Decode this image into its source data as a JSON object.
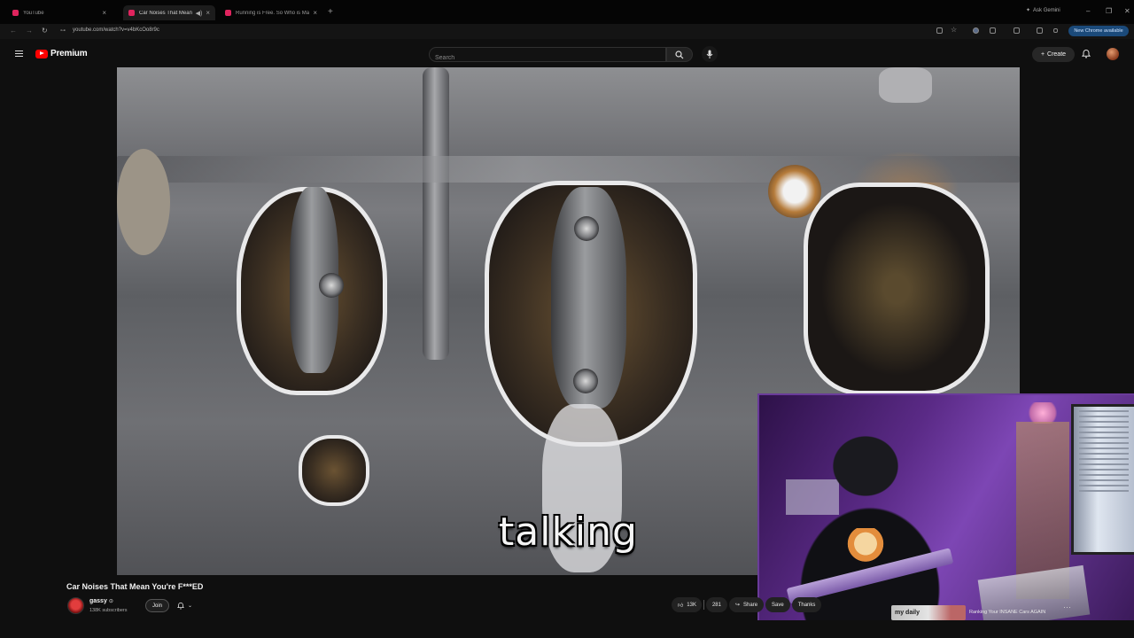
{
  "browser": {
    "tabs": [
      {
        "title": "YouTube",
        "active": false
      },
      {
        "title": "Car Noises That Mean You",
        "active": true
      },
      {
        "title": "Running is Free. So Who is Ma",
        "active": false
      }
    ],
    "new_tab": "+",
    "ask_gemini": "Ask Gemini",
    "url": "youtube.com/watch?v=v4bKcOo8r9c",
    "new_chrome_available": "New Chrome available"
  },
  "header": {
    "brand": "Premium",
    "search_placeholder": "Search",
    "create_label": "Create"
  },
  "video": {
    "caption": "talking",
    "title": "Car Noises That Mean You're F***ED"
  },
  "channel": {
    "name": "gassy",
    "subscribers": "138K subscribers",
    "join_label": "Join"
  },
  "actions": {
    "likes": "13K",
    "comments": "281",
    "share_label": "Share",
    "save_label": "Save",
    "thanks_label": "Thanks"
  },
  "recommendation": {
    "thumb_text": "my daily",
    "title": "Ranking Your INSANE Cars AGAIN"
  },
  "colors": {
    "accent": "#ff0000",
    "background": "#0f0f0f",
    "webcam_tint": "#5a2a86"
  }
}
